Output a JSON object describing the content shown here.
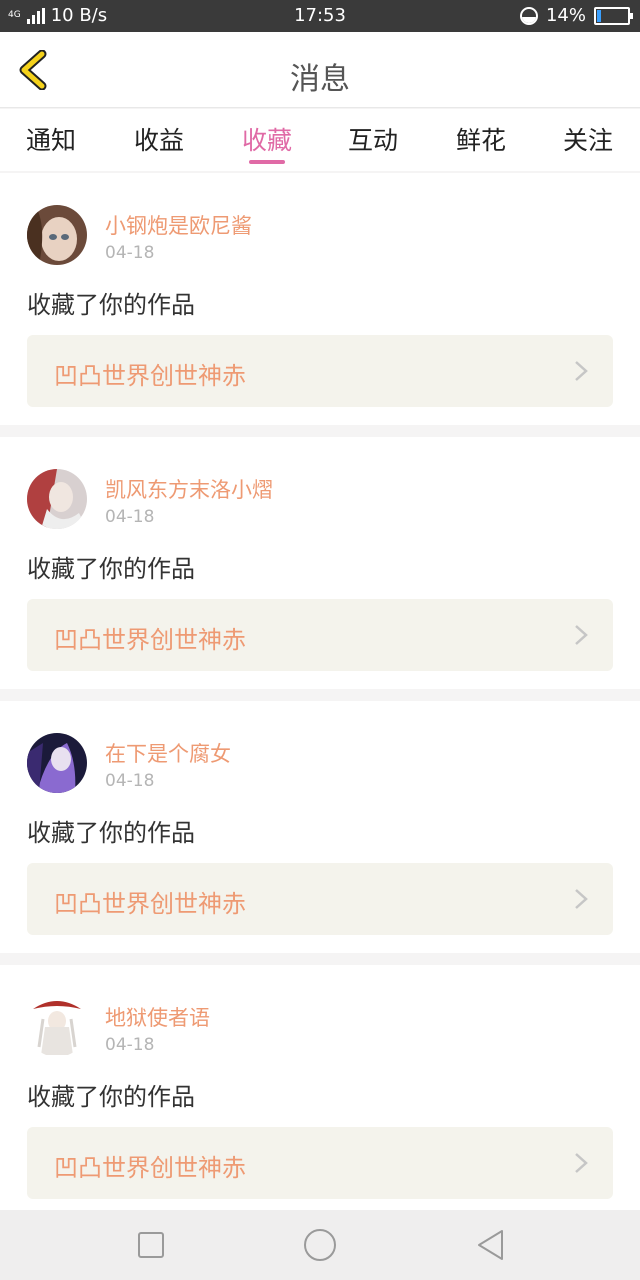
{
  "status": {
    "network": "4G",
    "speed": "10 B/s",
    "time": "17:53",
    "battery_percent": "14%",
    "battery_level": 0.14
  },
  "header": {
    "title": "消息",
    "back_icon": "chevron-left-icon"
  },
  "tabs": [
    {
      "label": "通知",
      "active": false
    },
    {
      "label": "收益",
      "active": false
    },
    {
      "label": "收藏",
      "active": true
    },
    {
      "label": "互动",
      "active": false
    },
    {
      "label": "鲜花",
      "active": false
    },
    {
      "label": "关注",
      "active": false
    }
  ],
  "items": [
    {
      "user": "小钢炮是欧尼酱",
      "date": "04-18",
      "action": "收藏了你的作品",
      "work": "凹凸世界创世神赤"
    },
    {
      "user": "凯风东方末洛小熠",
      "date": "04-18",
      "action": "收藏了你的作品",
      "work": "凹凸世界创世神赤"
    },
    {
      "user": "在下是个腐女",
      "date": "04-18",
      "action": "收藏了你的作品",
      "work": "凹凸世界创世神赤"
    },
    {
      "user": "地狱使者语",
      "date": "04-18",
      "action": "收藏了你的作品",
      "work": "凹凸世界创世神赤"
    }
  ],
  "colors": {
    "accent_pink": "#e06aa6",
    "accent_orange": "#ee9a73",
    "back_yellow": "#f5d21b"
  },
  "navbar": {
    "icons": [
      "square-icon",
      "circle-icon",
      "triangle-back-icon"
    ]
  }
}
